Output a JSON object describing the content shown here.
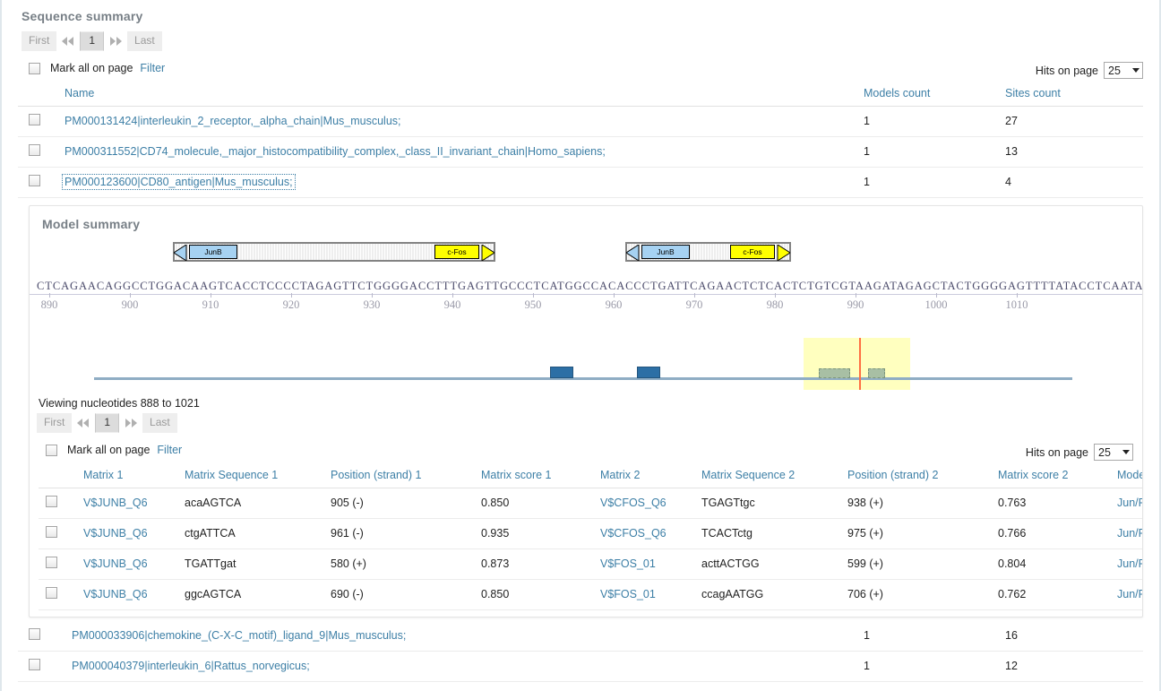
{
  "header": {
    "title": "Sequence summary"
  },
  "pager_top": {
    "first": "First",
    "prev": "prev-page",
    "current": "1",
    "next": "next-page",
    "last": "Last"
  },
  "mark_top": {
    "label": "Mark all on page",
    "filter": "Filter"
  },
  "hits_top": {
    "label": "Hits on page",
    "value": "25"
  },
  "sequence_table": {
    "columns": [
      "Name",
      "Models count",
      "Sites count"
    ],
    "rows": [
      {
        "name": "PM000131424|interleukin_2_receptor,_alpha_chain|Mus_musculus;",
        "models": "1",
        "sites": "27",
        "focused": false
      },
      {
        "name": "PM000311552|CD74_molecule,_major_histocompatibility_complex,_class_II_invariant_chain|Homo_sapiens;",
        "models": "1",
        "sites": "13",
        "focused": false
      },
      {
        "name": "PM000123600|CD80_antigen|Mus_musculus;",
        "models": "1",
        "sites": "4",
        "focused": true
      }
    ],
    "rows_bottom": [
      {
        "name": "PM000033906|chemokine_(C-X-C_motif)_ligand_9|Mus_musculus;",
        "models": "1",
        "sites": "16"
      },
      {
        "name": "PM000040379|interleukin_6|Rattus_norvegicus;",
        "models": "1",
        "sites": "12"
      }
    ]
  },
  "model_summary": {
    "title": "Model summary",
    "models": [
      {
        "left_tf": "JunB",
        "right_tf": "c-Fos"
      },
      {
        "left_tf": "JunB",
        "right_tf": "c-Fos"
      }
    ],
    "sequence": "CTCAGAACAGGCCTGGACAAGTCACCTCCCCTAGAGTTCTGGGGACCTTTGAGTTGCCCTCATGGCCACACCCTGATTCAGAACTCTCACTCTGTCGTAAGATAGAGCTACTGGGGAGTTTTATACCTCAATAG",
    "ruler_ticks": [
      "890",
      "900",
      "910",
      "920",
      "930",
      "940",
      "950",
      "960",
      "970",
      "980",
      "990",
      "1000",
      "1010"
    ],
    "viewing": "Viewing nucleotides 888 to 1021",
    "pager": {
      "first": "First",
      "prev": "prev-page",
      "current": "1",
      "next": "next-page",
      "last": "Last"
    },
    "mark": {
      "label": "Mark all on page",
      "filter": "Filter"
    },
    "hits": {
      "label": "Hits on page",
      "value": "25"
    },
    "overview": {
      "bars": [
        {
          "left_pct": 46.6,
          "width_pct": 2.4,
          "kind": "blue"
        },
        {
          "left_pct": 55.5,
          "width_pct": 2.4,
          "kind": "blue"
        },
        {
          "left_pct": 74.1,
          "width_pct": 3.2,
          "kind": "green"
        },
        {
          "left_pct": 79.1,
          "width_pct": 1.8,
          "kind": "green"
        }
      ],
      "highlight": {
        "left_pct": 72.5,
        "width_pct": 10.9
      },
      "marker_pct": 78.2
    },
    "matches_table": {
      "columns": [
        "Matrix 1",
        "Matrix Sequence 1",
        "Position (strand) 1",
        "Matrix score 1",
        "Matrix 2",
        "Matrix Sequence 2",
        "Position (strand) 2",
        "Matrix score 2",
        "Model"
      ],
      "rows": [
        {
          "m1": "V$JUNB_Q6",
          "s1": "acaAGTCA",
          "p1": "905 (-)",
          "sc1": "0.850",
          "m2": "V$CFOS_Q6",
          "s2": "TGAGTtgc",
          "p2": "938 (+)",
          "sc2": "0.763",
          "model": "Jun/Fos"
        },
        {
          "m1": "V$JUNB_Q6",
          "s1": "ctgATTCA",
          "p1": "961 (-)",
          "sc1": "0.935",
          "m2": "V$CFOS_Q6",
          "s2": "TCACTctg",
          "p2": "975 (+)",
          "sc2": "0.766",
          "model": "Jun/Fos"
        },
        {
          "m1": "V$JUNB_Q6",
          "s1": "TGATTgat",
          "p1": "580 (+)",
          "sc1": "0.873",
          "m2": "V$FOS_01",
          "s2": "acttACTGG",
          "p2": "599 (+)",
          "sc2": "0.804",
          "model": "Jun/Fos"
        },
        {
          "m1": "V$JUNB_Q6",
          "s1": "ggcAGTCA",
          "p1": "690 (-)",
          "sc1": "0.850",
          "m2": "V$FOS_01",
          "s2": "ccagAATGG",
          "p2": "706 (+)",
          "sc2": "0.762",
          "model": "Jun/Fos"
        }
      ]
    }
  },
  "colors": {
    "link": "#3d7fa6",
    "title": "#777f86",
    "tf_blue": "#a6d2f2",
    "tf_yellow": "#ffff00",
    "bar_blue": "#2c6fa5",
    "bar_green": "#a8bfa4",
    "highlight": "#ffffbf",
    "marker": "#ff7043"
  }
}
